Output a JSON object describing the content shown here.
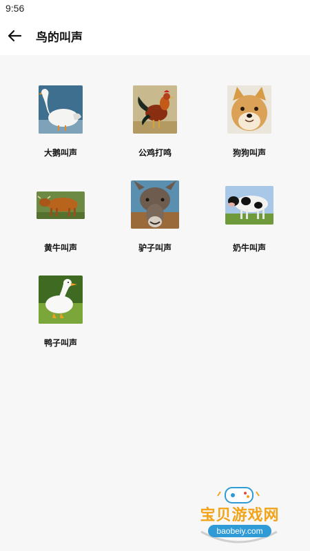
{
  "status_bar": {
    "time": "9:56"
  },
  "header": {
    "title": "鸟的叫声"
  },
  "icons": {
    "back": "arrow-left-icon"
  },
  "items": [
    {
      "label": "大鹅叫声",
      "image": "goose"
    },
    {
      "label": "公鸡打鸣",
      "image": "rooster"
    },
    {
      "label": "狗狗叫声",
      "image": "shiba-dog"
    },
    {
      "label": "黄牛叫声",
      "image": "yellow-cattle"
    },
    {
      "label": "驴子叫声",
      "image": "donkey"
    },
    {
      "label": "奶牛叫声",
      "image": "dairy-cow"
    },
    {
      "label": "鸭子叫声",
      "image": "duck"
    }
  ],
  "watermark": {
    "name": "宝贝游戏网",
    "url": "baobeiy.com"
  }
}
